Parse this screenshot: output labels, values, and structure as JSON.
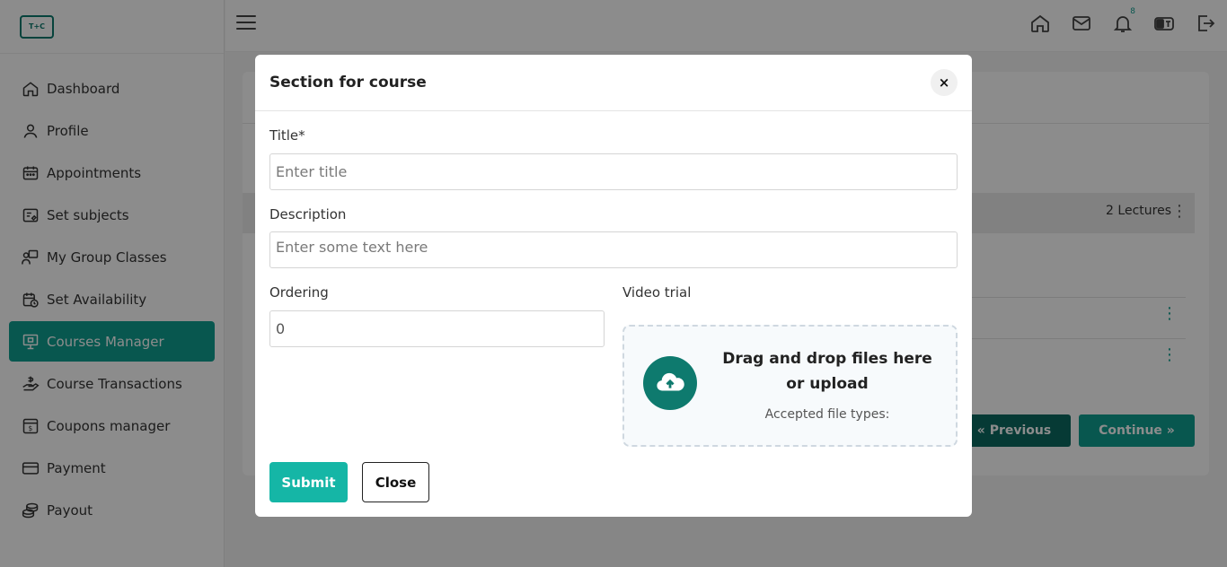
{
  "logo": {
    "text": "T+C"
  },
  "sidebar": {
    "items": [
      {
        "label": "Dashboard",
        "icon": "home-icon",
        "active": false
      },
      {
        "label": "Profile",
        "icon": "user-icon",
        "active": false
      },
      {
        "label": "Appointments",
        "icon": "calendar-icon",
        "active": false
      },
      {
        "label": "Set subjects",
        "icon": "subjects-icon",
        "active": false
      },
      {
        "label": "My Group Classes",
        "icon": "group-class-icon",
        "active": false
      },
      {
        "label": "Set Availability",
        "icon": "availability-icon",
        "active": false
      },
      {
        "label": "Courses Manager",
        "icon": "monitor-icon",
        "active": true
      },
      {
        "label": "Course Transactions",
        "icon": "transactions-icon",
        "active": false
      },
      {
        "label": "Coupons manager",
        "icon": "coupon-icon",
        "active": false
      },
      {
        "label": "Payment",
        "icon": "card-icon",
        "active": false
      },
      {
        "label": "Payout",
        "icon": "coins-icon",
        "active": false
      }
    ]
  },
  "topbar": {
    "notification_count": "8"
  },
  "background": {
    "lectures": "2 Lectures",
    "prev_label": "« Previous",
    "continue_label": "Continue »"
  },
  "modal": {
    "title": "Section for course",
    "close_symbol": "×",
    "title_label": "Title*",
    "title_placeholder": "Enter title",
    "description_label": "Description",
    "description_placeholder": "Enter some text here",
    "ordering_label": "Ordering",
    "ordering_value": "0",
    "video_label": "Video trial",
    "drop_text": "Drag and drop files here or upload",
    "accepted_text": "Accepted file types:",
    "submit_label": "Submit",
    "close_label": "Close"
  },
  "colors": {
    "accent": "#0f9e90",
    "accent_dark": "#0b6b62",
    "submit": "#15b6a6"
  }
}
